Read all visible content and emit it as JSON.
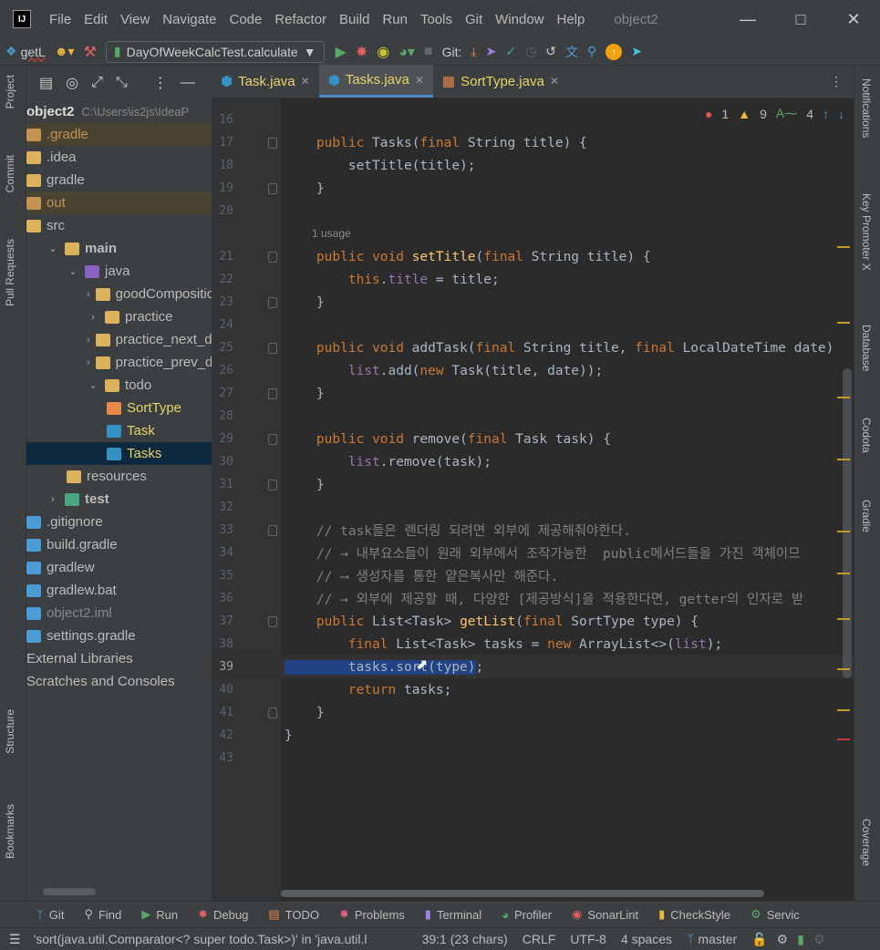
{
  "menu": {
    "items": [
      "File",
      "Edit",
      "View",
      "Navigate",
      "Code",
      "Refactor",
      "Build",
      "Run",
      "Tools",
      "Git",
      "Window",
      "Help"
    ],
    "project_title": "object2"
  },
  "toolbar": {
    "branch_label": "getL",
    "run_config": "DayOfWeekCalcTest.calculate",
    "git_label": "Git:"
  },
  "left_tabs": [
    "Project",
    "Commit",
    "Pull Requests",
    "Structure",
    "Bookmarks"
  ],
  "right_tabs": [
    "Notifications",
    "Key Promoter X",
    "Database",
    "Codota",
    "Gradle",
    "Coverage"
  ],
  "project_tree": {
    "root_label": "object2",
    "root_path": "C:\\Users\\is2js\\IdeaP",
    "rows": [
      {
        "label": ".gradle",
        "depth": 0,
        "icon": "folder-orange",
        "arrow": ""
      },
      {
        "label": ".idea",
        "depth": 0,
        "icon": "folder",
        "arrow": ""
      },
      {
        "label": "gradle",
        "depth": 0,
        "icon": "folder",
        "arrow": ""
      },
      {
        "label": "out",
        "depth": 0,
        "icon": "folder-orange",
        "arrow": ""
      },
      {
        "label": "src",
        "depth": 0,
        "icon": "folder",
        "arrow": ""
      },
      {
        "label": "main",
        "depth": 1,
        "icon": "folder",
        "arrow": "v"
      },
      {
        "label": "java",
        "depth": 2,
        "icon": "folder-blue",
        "arrow": "v"
      },
      {
        "label": "goodComposition",
        "depth": 3,
        "icon": "folder",
        "arrow": ">"
      },
      {
        "label": "practice",
        "depth": 3,
        "icon": "folder",
        "arrow": ">"
      },
      {
        "label": "practice_next_dec",
        "depth": 3,
        "icon": "folder",
        "arrow": ">"
      },
      {
        "label": "practice_prev_dec",
        "depth": 3,
        "icon": "folder",
        "arrow": ">"
      },
      {
        "label": "todo",
        "depth": 3,
        "icon": "folder",
        "arrow": "v"
      },
      {
        "label": "SortType",
        "depth": 4,
        "icon": "enum",
        "arrow": ""
      },
      {
        "label": "Task",
        "depth": 4,
        "icon": "class",
        "arrow": ""
      },
      {
        "label": "Tasks",
        "depth": 4,
        "icon": "class",
        "arrow": ""
      },
      {
        "label": "resources",
        "depth": 2,
        "icon": "folder",
        "arrow": ""
      },
      {
        "label": "test",
        "depth": 1,
        "icon": "folder-green",
        "arrow": ">"
      },
      {
        "label": ".gitignore",
        "depth": 0,
        "icon": "file",
        "arrow": ""
      },
      {
        "label": "build.gradle",
        "depth": 0,
        "icon": "file",
        "arrow": ""
      },
      {
        "label": "gradlew",
        "depth": 0,
        "icon": "file",
        "arrow": ""
      },
      {
        "label": "gradlew.bat",
        "depth": 0,
        "icon": "file",
        "arrow": ""
      },
      {
        "label": "object2.iml",
        "depth": 0,
        "icon": "file",
        "arrow": ""
      },
      {
        "label": "settings.gradle",
        "depth": 0,
        "icon": "file",
        "arrow": ""
      },
      {
        "label": "External Libraries",
        "depth": -1,
        "icon": "",
        "arrow": ""
      },
      {
        "label": "Scratches and Consoles",
        "depth": -1,
        "icon": "",
        "arrow": ""
      }
    ]
  },
  "editor_tabs": [
    {
      "label": "Task.java",
      "active": false
    },
    {
      "label": "Tasks.java",
      "active": true
    },
    {
      "label": "SortType.java",
      "active": false
    }
  ],
  "inspections": {
    "errors": "1",
    "warnings": "9",
    "typos": "4"
  },
  "usage_hint": "1 usage",
  "code_lines": [
    {
      "num": "16",
      "html": ""
    },
    {
      "num": "17",
      "html": "    <span class=kw>public</span> Tasks(<span class=kw>final</span> String title) {"
    },
    {
      "num": "18",
      "html": "        setTitle(title);"
    },
    {
      "num": "19",
      "html": "    }"
    },
    {
      "num": "20",
      "html": ""
    },
    {
      "num": "21",
      "html": "    <span class=kw>public void</span> <span class=fn>setTitle</span>(<span class=kw>final</span> String title) {"
    },
    {
      "num": "22",
      "html": "        <span class=kw>this</span>.<span class=fld>title</span> = title;"
    },
    {
      "num": "23",
      "html": "    }"
    },
    {
      "num": "24",
      "html": ""
    },
    {
      "num": "25",
      "html": "    <span class=kw>public void</span> addTask(<span class=kw>final</span> String title, <span class=kw>final</span> LocalDateTime date)"
    },
    {
      "num": "26",
      "html": "        <span class=fld>list</span>.add(<span class=kw>new</span> Task(title, date));"
    },
    {
      "num": "27",
      "html": "    }"
    },
    {
      "num": "28",
      "html": ""
    },
    {
      "num": "29",
      "html": "    <span class=kw>public void</span> remove(<span class=kw>final</span> Task task) {"
    },
    {
      "num": "30",
      "html": "        <span class=fld>list</span>.remove(task);"
    },
    {
      "num": "31",
      "html": "    }"
    },
    {
      "num": "32",
      "html": ""
    },
    {
      "num": "33",
      "html": "    <span class=cm>// task들은 렌더링 되려면 외부에 제공해줘야한다.</span>"
    },
    {
      "num": "34",
      "html": "    <span class=cm>// → 내부요소들이 원래 외부에서 조작가능한  public메서드들을 가진 객체이므</span>"
    },
    {
      "num": "35",
      "html": "    <span class=cm>// ⟶ 생성자를 통한 얕은복사만 해준다.</span>"
    },
    {
      "num": "36",
      "html": "    <span class=cm>// → 외부에 제공할 때, 다양한 [제공방식]을 적용한다면, getter의 인자로 받</span>"
    },
    {
      "num": "37",
      "html": "    <span class=kw>public</span> List&lt;Task&gt; <span class=fn>getList</span>(<span class=kw>final</span> SortType type) {"
    },
    {
      "num": "38",
      "html": "        <span class=kw>final</span> List&lt;Task&gt; tasks = <span class=kw>new</span> ArrayList&lt;&gt;(<span class=fld>list</span>);"
    },
    {
      "num": "39",
      "html": "<span class=sel>        tasks.sort(type)</span>;"
    },
    {
      "num": "40",
      "html": "        <span class=kw>return</span> tasks;"
    },
    {
      "num": "41",
      "html": "    }"
    },
    {
      "num": "42",
      "html": "}"
    },
    {
      "num": "43",
      "html": ""
    }
  ],
  "bottom_tools": [
    "Git",
    "Find",
    "Run",
    "Debug",
    "TODO",
    "Problems",
    "Terminal",
    "Profiler",
    "SonarLint",
    "CheckStyle",
    "Servic"
  ],
  "status": {
    "message": "'sort(java.util.Comparator<? super todo.Task>)' in 'java.util.l",
    "position": "39:1 (23 chars)",
    "line_sep": "CRLF",
    "encoding": "UTF-8",
    "indent": "4 spaces",
    "branch": "master"
  }
}
